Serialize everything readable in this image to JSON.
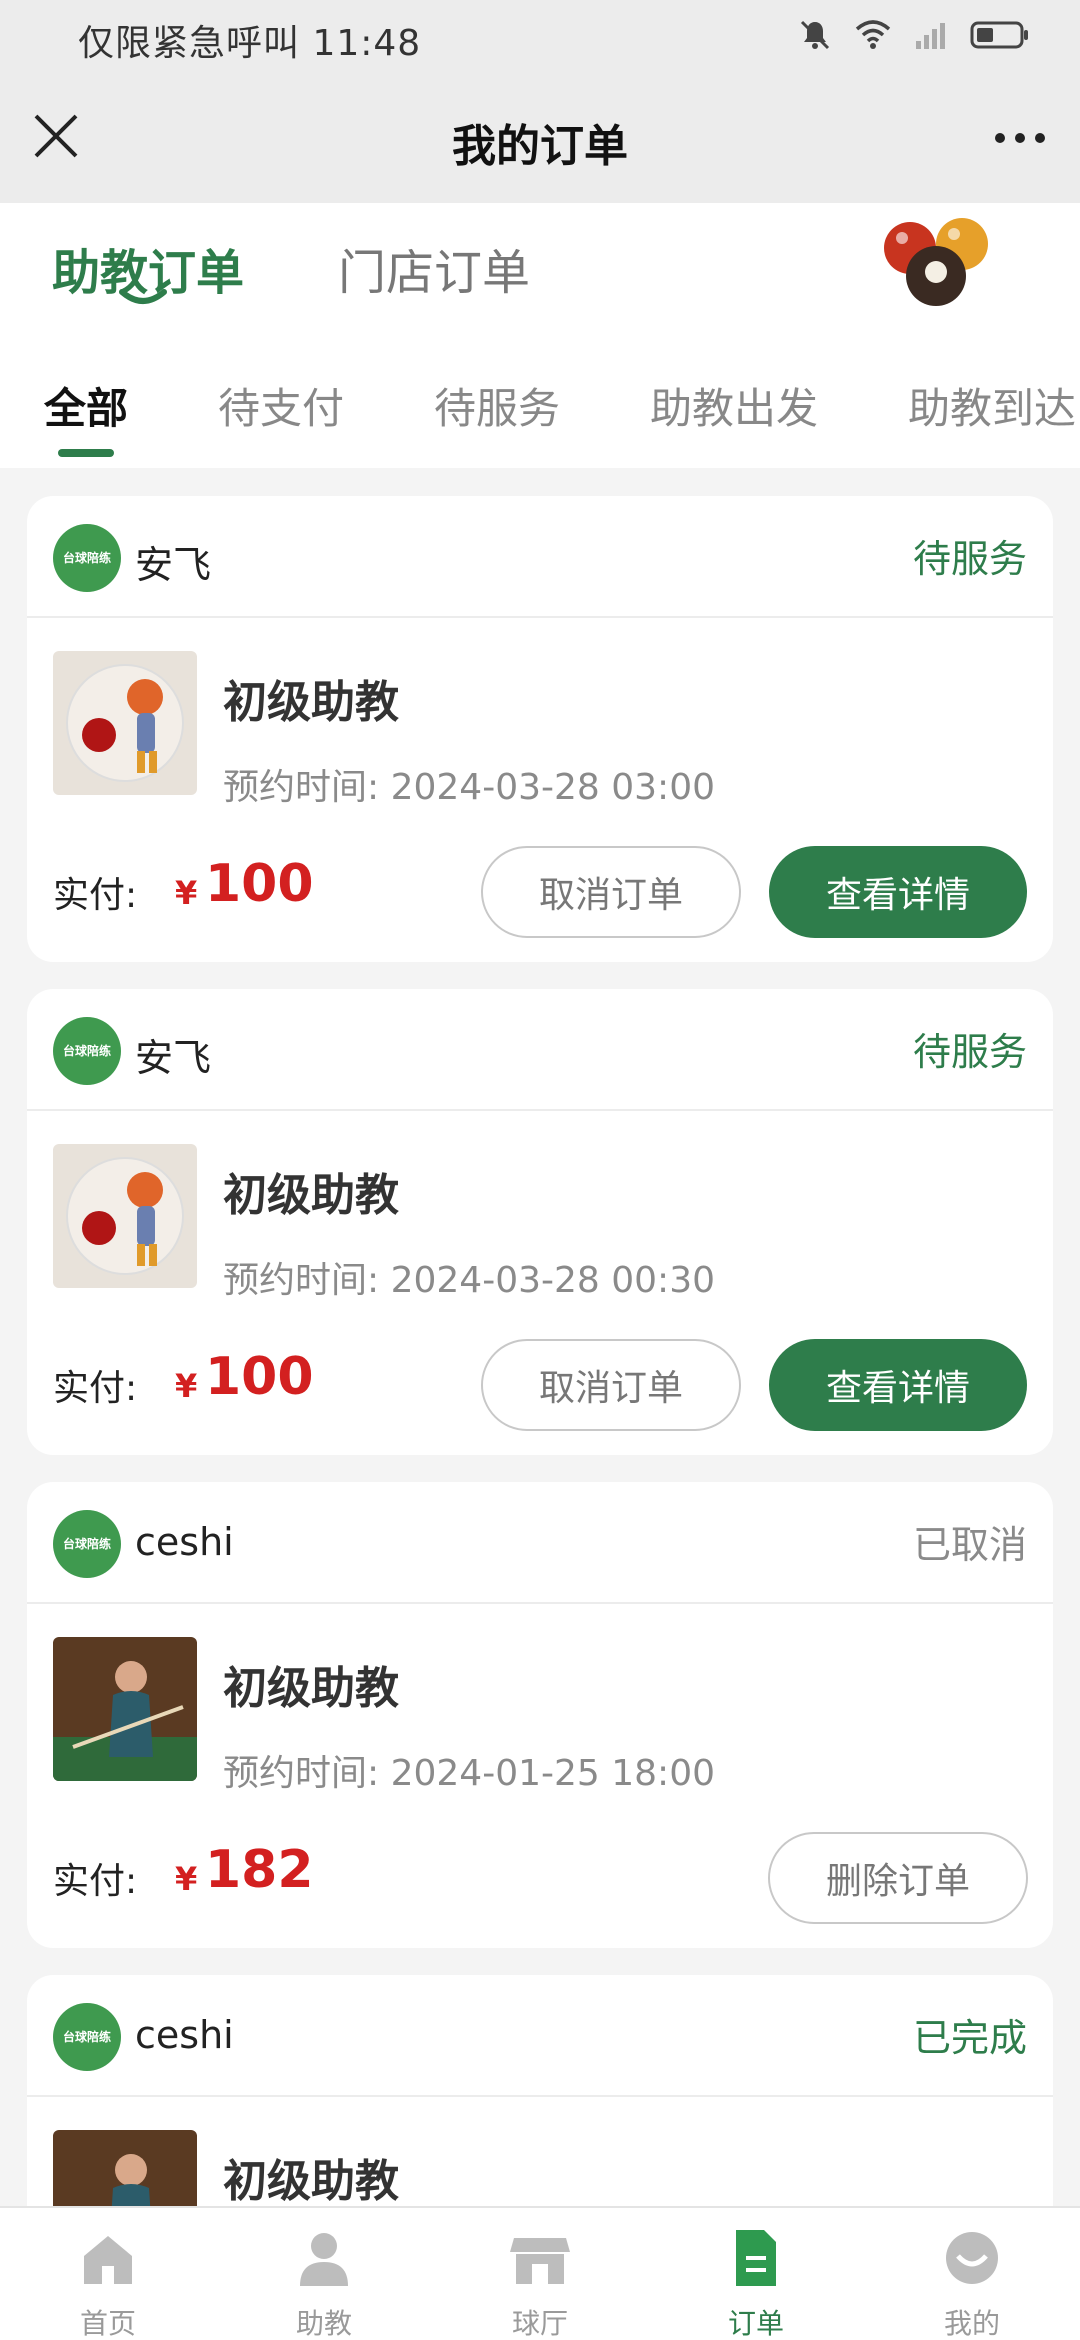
{
  "status_bar": {
    "carrier_time": "仅限紧急呼叫 11:48"
  },
  "header": {
    "title": "我的订单"
  },
  "top_tabs": [
    {
      "label": "助教订单",
      "active": true
    },
    {
      "label": "门店订单",
      "active": false
    }
  ],
  "status_tabs": [
    {
      "label": "全部",
      "active": true
    },
    {
      "label": "待支付"
    },
    {
      "label": "待服务"
    },
    {
      "label": "助教出发"
    },
    {
      "label": "助教到达"
    }
  ],
  "brand_badge_text": "台球陪练",
  "orders": [
    {
      "shop": "安飞",
      "status": "待服务",
      "status_color": "#2e7d4b",
      "service": "初级助教",
      "appt_label": "预约时间:",
      "appt_time": "2024-03-28 03:00",
      "paid_label": "实付:",
      "currency": "¥",
      "price": "100",
      "btn_cancel": "取消订单",
      "btn_detail": "查看详情"
    },
    {
      "shop": "安飞",
      "status": "待服务",
      "status_color": "#2e7d4b",
      "service": "初级助教",
      "appt_label": "预约时间:",
      "appt_time": "2024-03-28 00:30",
      "paid_label": "实付:",
      "currency": "¥",
      "price": "100",
      "btn_cancel": "取消订单",
      "btn_detail": "查看详情"
    },
    {
      "shop": "ceshi",
      "status": "已取消",
      "status_color": "#8a8a8a",
      "service": "初级助教",
      "appt_label": "预约时间:",
      "appt_time": "2024-01-25 18:00",
      "paid_label": "实付:",
      "currency": "¥",
      "price": "182",
      "btn_delete": "删除订单"
    },
    {
      "shop": "ceshi",
      "status": "已完成",
      "status_color": "#2e7d4b",
      "service": "初级助教"
    }
  ],
  "bottom_nav": [
    {
      "label": "首页",
      "icon": "home-icon"
    },
    {
      "label": "助教",
      "icon": "person-icon"
    },
    {
      "label": "球厅",
      "icon": "store-icon"
    },
    {
      "label": "订单",
      "icon": "order-icon",
      "active": true
    },
    {
      "label": "我的",
      "icon": "profile-icon"
    }
  ],
  "colors": {
    "accent": "#2e7d4b",
    "price": "#d32020"
  }
}
